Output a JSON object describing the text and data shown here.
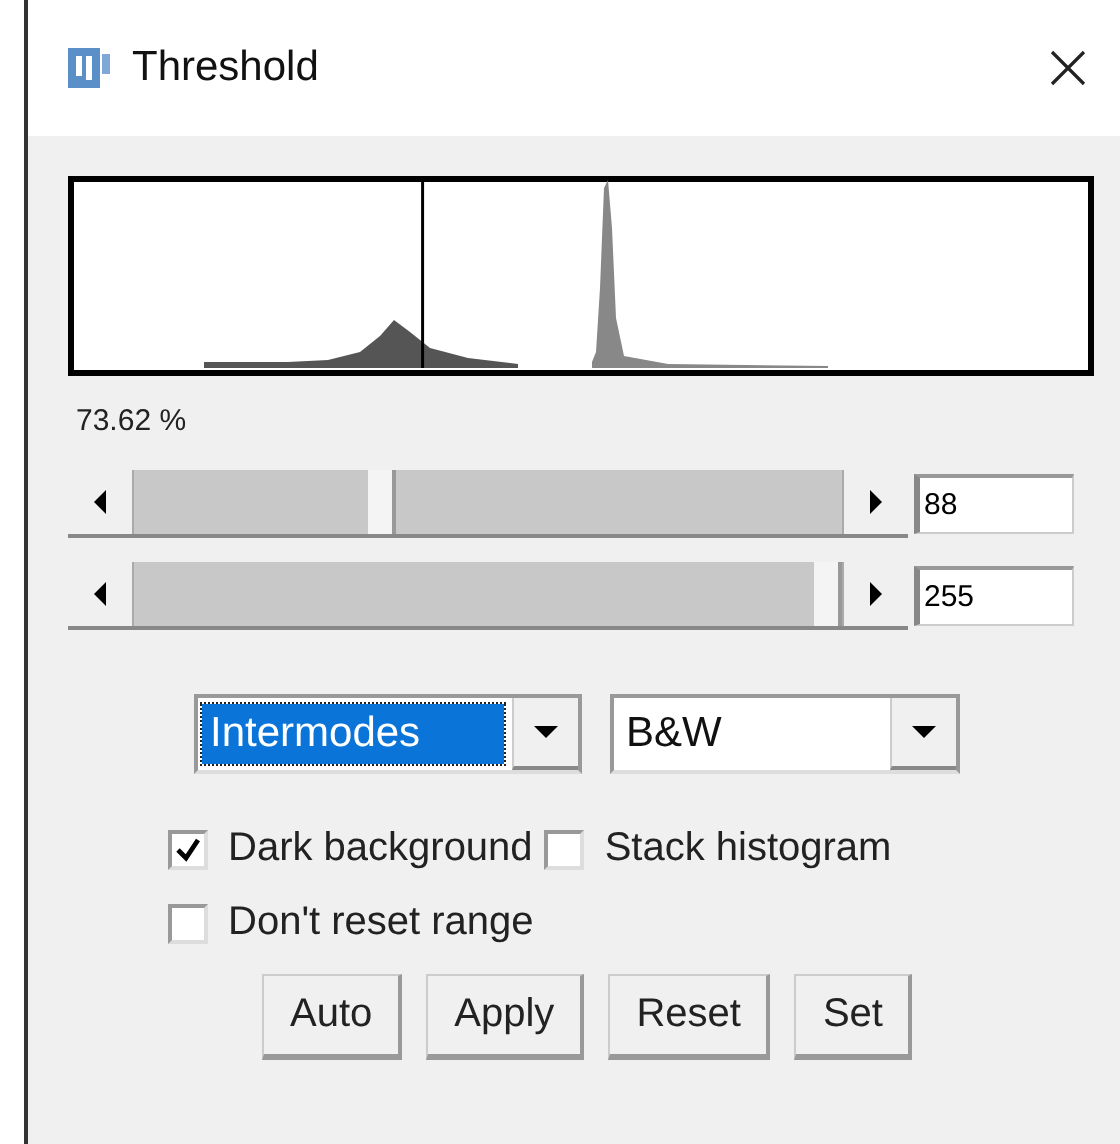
{
  "window": {
    "title": "Threshold"
  },
  "percent": "73.62 %",
  "sliders": [
    {
      "value": "88"
    },
    {
      "value": "255"
    }
  ],
  "dropdowns": [
    {
      "value": "Intermodes",
      "focused": true
    },
    {
      "value": "B&W",
      "focused": false
    }
  ],
  "checkboxes": [
    {
      "label": "Dark background",
      "checked": true
    },
    {
      "label": "Stack histogram",
      "checked": false
    },
    {
      "label": "Don't reset range",
      "checked": false
    }
  ],
  "buttons": [
    "Auto",
    "Apply",
    "Reset",
    "Set"
  ]
}
